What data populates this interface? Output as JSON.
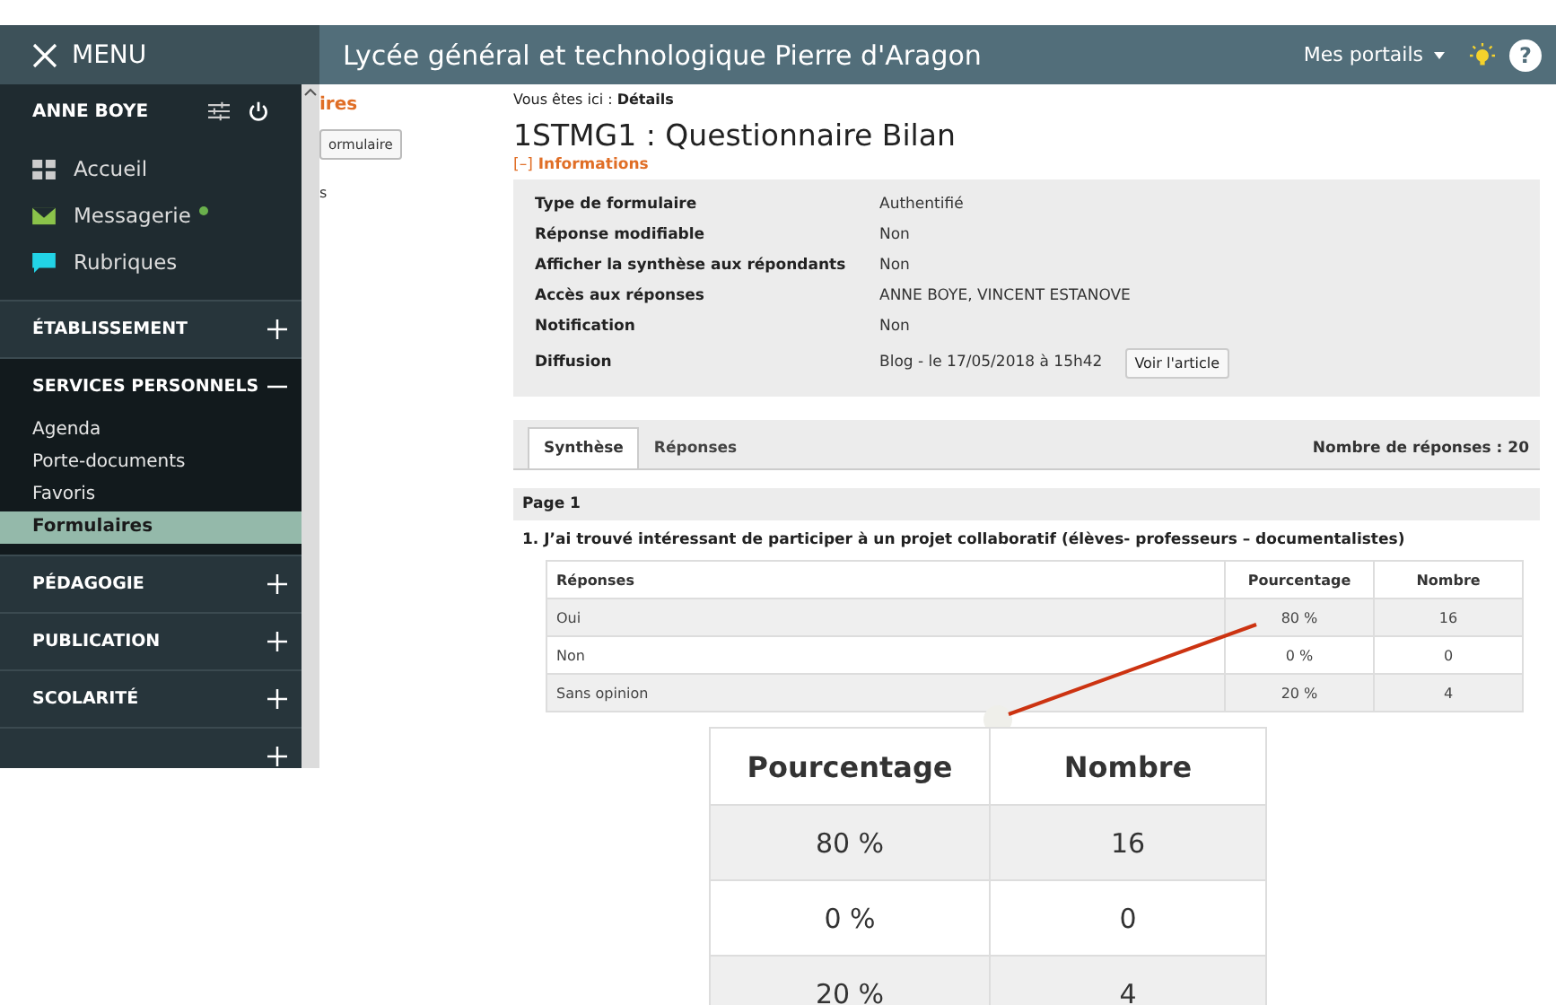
{
  "header": {
    "menu_label": "MENU",
    "site_title": "Lycée général et technologique Pierre d'Aragon",
    "portals": "Mes portails",
    "help": "?"
  },
  "sidebar": {
    "user": "ANNE BOYE",
    "links": [
      {
        "label": "Accueil",
        "kind": "home",
        "unread": false
      },
      {
        "label": "Messagerie",
        "kind": "messages",
        "unread": true
      },
      {
        "label": "Rubriques",
        "kind": "topics",
        "unread": false
      }
    ],
    "sections": [
      {
        "title": "ÉTABLISSEMENT",
        "expanded": false
      },
      {
        "title": "SERVICES PERSONNELS",
        "expanded": true,
        "items": [
          {
            "label": "Agenda",
            "selected": false
          },
          {
            "label": "Porte-documents",
            "selected": false
          },
          {
            "label": "Favoris",
            "selected": false
          },
          {
            "label": "Formulaires",
            "selected": true
          }
        ]
      },
      {
        "title": "PÉDAGOGIE",
        "expanded": false
      },
      {
        "title": "PUBLICATION",
        "expanded": false
      },
      {
        "title": "SCOLARITÉ",
        "expanded": false
      },
      {
        "expanded": false
      }
    ]
  },
  "background_panel": {
    "heading": "ires",
    "button": "ormulaire",
    "text": "s"
  },
  "breadcrumb": {
    "label": "Vous êtes ici :",
    "current": "Détails"
  },
  "title": "1STMG1 : Questionnaire Bilan",
  "informations": {
    "toggle": "[–]",
    "label": "Informations",
    "rows": [
      {
        "label": "Type de formulaire",
        "value": "Authentifié"
      },
      {
        "label": "Réponse modifiable",
        "value": "Non"
      },
      {
        "label": "Afficher la synthèse aux répondants",
        "value": "Non"
      },
      {
        "label": "Accès aux réponses",
        "value": "ANNE BOYE, VINCENT ESTANOVE"
      },
      {
        "label": "Notification",
        "value": "Non"
      },
      {
        "label": "Diffusion",
        "value": "Blog - le 17/05/2018 à 15h42",
        "button": "Voir l'article"
      }
    ]
  },
  "tabs": [
    {
      "label": "Synthèse",
      "selected": true
    },
    {
      "label": "Réponses",
      "selected": false
    }
  ],
  "response_count": "Nombre de réponses : 20",
  "page_label": "Page 1",
  "question": "1. J’ai trouvé intéressant de participer à un projet collaboratif (élèves- professeurs – documentalistes)",
  "table": {
    "columns": [
      "Réponses",
      "Pourcentage",
      "Nombre"
    ],
    "rows": [
      [
        "Oui",
        "80 %",
        "16"
      ],
      [
        "Non",
        "0 %",
        "0"
      ],
      [
        "Sans opinion",
        "20 %",
        "4"
      ]
    ]
  },
  "callout": {
    "columns": [
      "Pourcentage",
      "Nombre"
    ],
    "rows": [
      [
        "80 %",
        "16"
      ],
      [
        "0 %",
        "0"
      ],
      [
        "20 %",
        "4"
      ]
    ]
  }
}
